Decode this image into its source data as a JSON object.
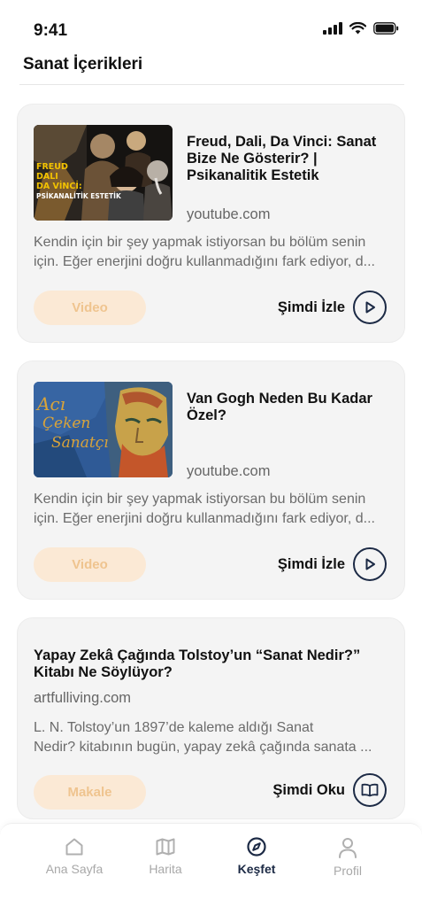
{
  "status_bar": {
    "time": "9:41"
  },
  "header": {
    "title": "Sanat İçerikleri"
  },
  "cards": [
    {
      "title_lines": [
        "Freud, Dali, Da Vinci: Sanat",
        "Bize Ne Gösterir? |",
        "Psikanalitik Estetik"
      ],
      "source": "youtube.com",
      "description_lines": [
        "Kendin için bir şey yapmak istiyorsan bu bölüm senin",
        "için. Eğer enerjini doğru kullanmadığını fark ediyor, d..."
      ],
      "badge": "Video",
      "action_label": "Şimdi İzle",
      "thumbnail_text": [
        "FREUD",
        "DALI",
        "DA VİNCİ:",
        "PSİKANALİTİK ESTETİK"
      ]
    },
    {
      "title_lines": [
        "Van Gogh Neden Bu Kadar",
        "Özel?"
      ],
      "source": "youtube.com",
      "description_lines": [
        "Kendin için bir şey yapmak istiyorsan bu bölüm senin",
        "için. Eğer enerjini doğru kullanmadığını fark ediyor, d..."
      ],
      "badge": "Video",
      "action_label": "Şimdi İzle",
      "thumbnail_text": [
        "Acı",
        "Çeken",
        "Sanatçı"
      ]
    },
    {
      "title_lines": [
        "Yapay Zekâ Çağında Tolstoy’un “Sanat Nedir?”",
        "Kitabı Ne Söylüyor?"
      ],
      "source": "artfulliving.com",
      "description_lines": [
        "L. N. Tolstoy’un 1897’de kaleme aldığı Sanat",
        "Nedir? kitabının bugün, yapay zekâ çağında sanata ..."
      ],
      "badge": "Makale",
      "action_label": "Şimdi Oku"
    }
  ],
  "bottom_nav": {
    "items": [
      {
        "label": "Ana Sayfa",
        "icon": "home-icon",
        "active": false
      },
      {
        "label": "Harita",
        "icon": "map-icon",
        "active": false
      },
      {
        "label": "Keşfet",
        "icon": "compass-icon",
        "active": true
      },
      {
        "label": "Profil",
        "icon": "user-icon",
        "active": false
      }
    ]
  },
  "colors": {
    "accent": "#1c2a45",
    "badge_bg": "#fbe9d5",
    "badge_text": "#efc48f",
    "card_bg": "#f4f4f4"
  }
}
